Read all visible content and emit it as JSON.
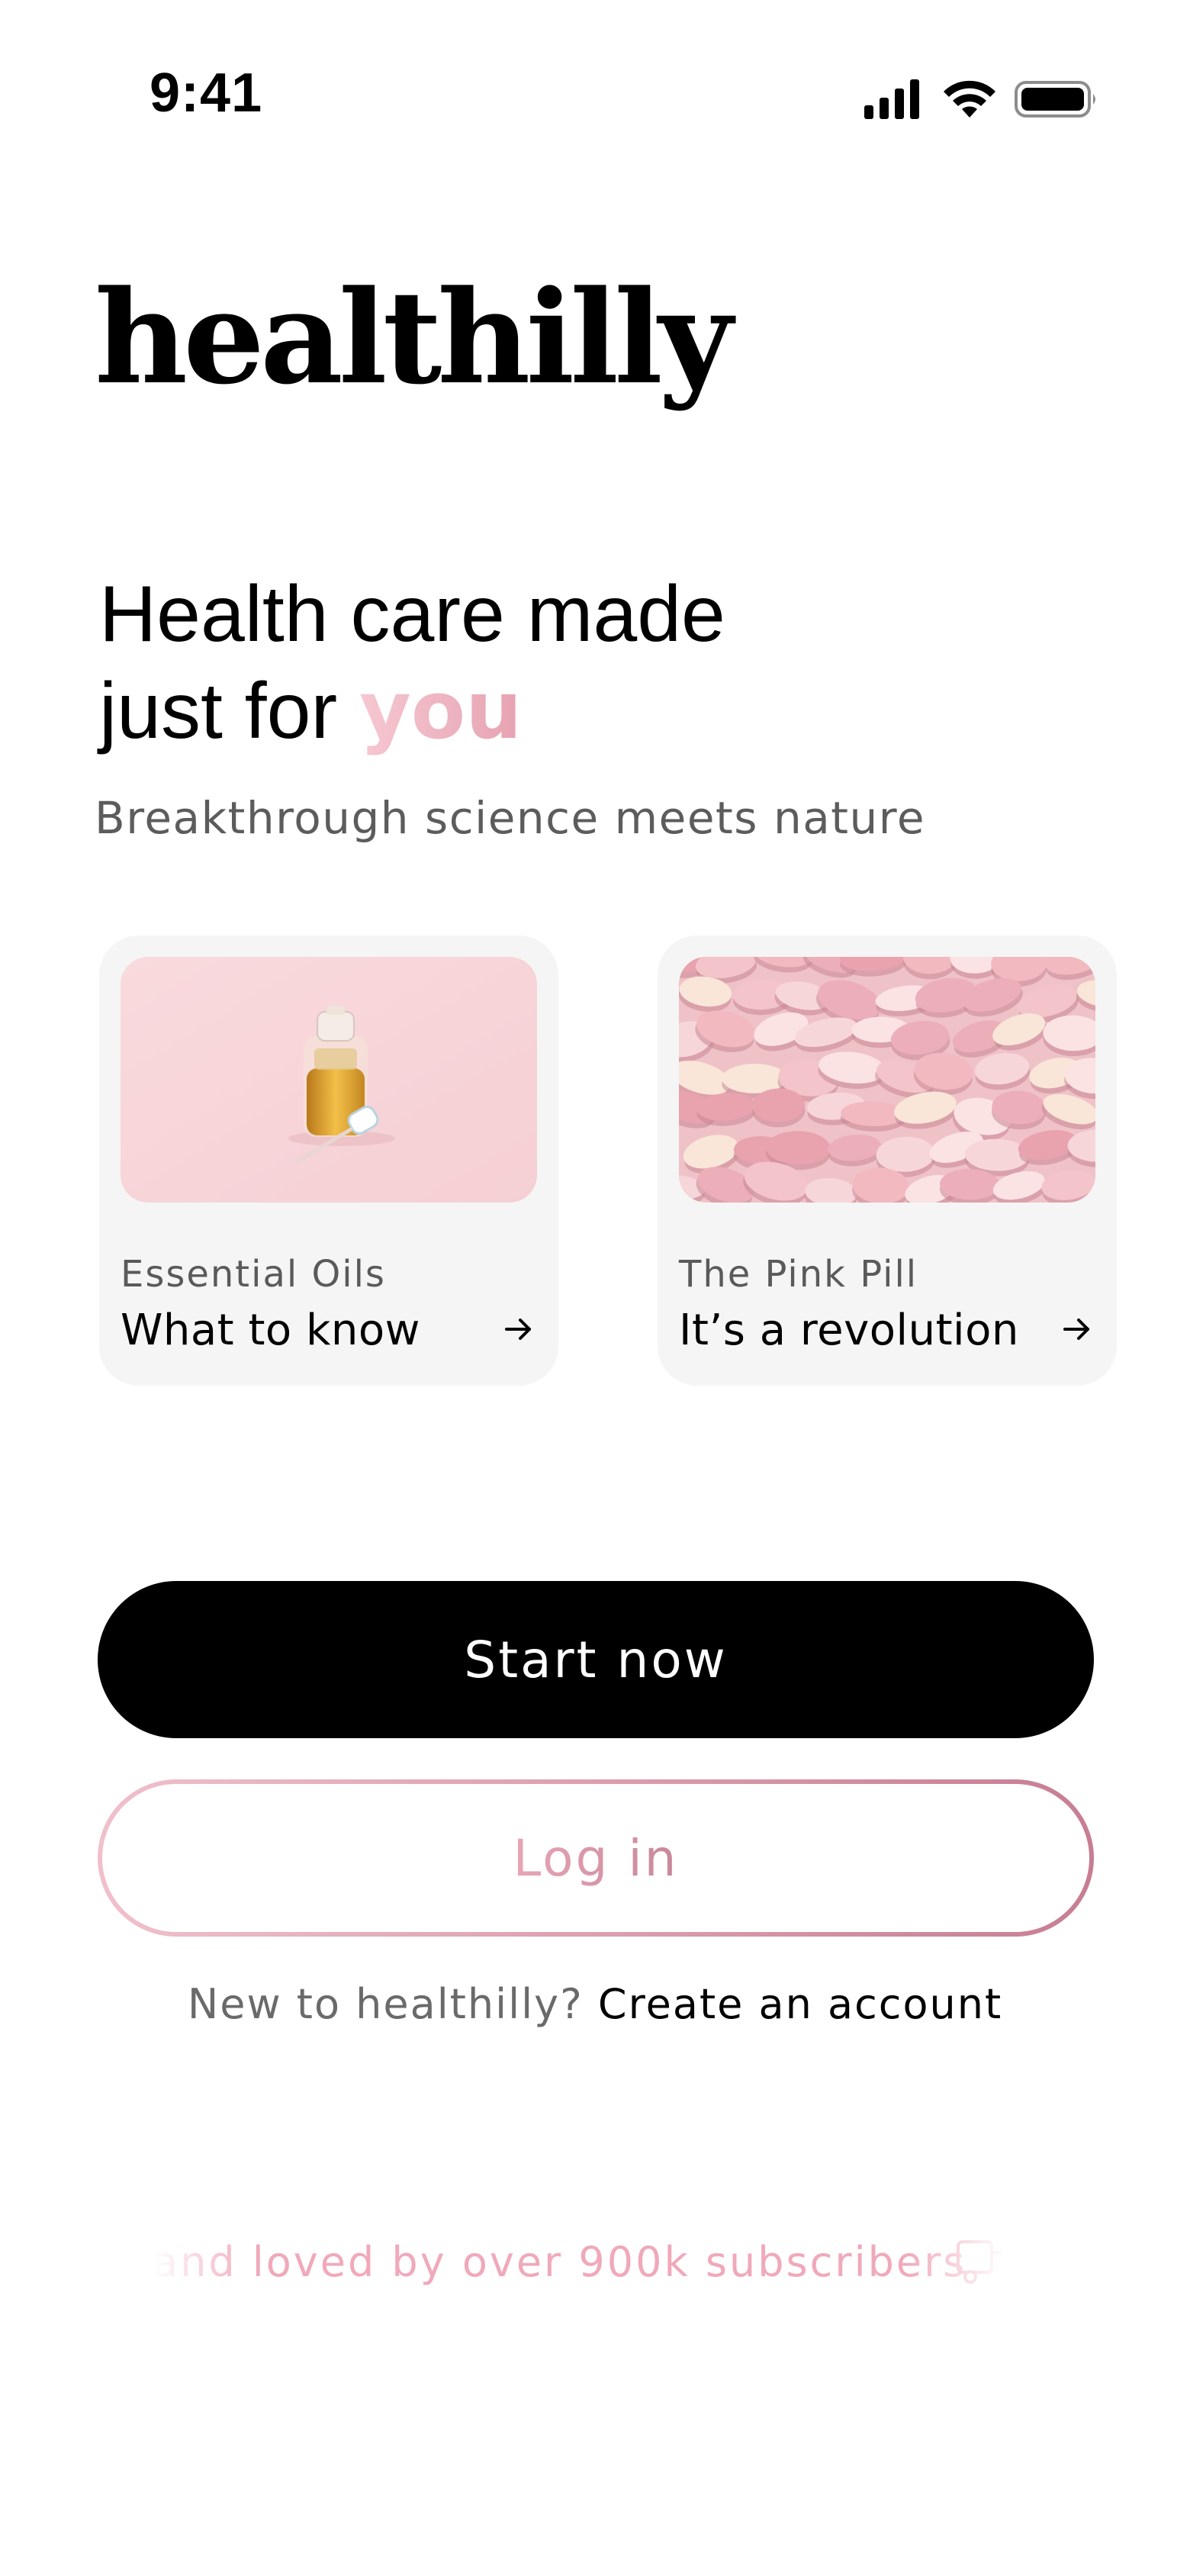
{
  "status_bar": {
    "time": "9:41",
    "icons": [
      "signal-icon",
      "wifi-icon",
      "battery-icon"
    ]
  },
  "brand": {
    "logo": "healthilly"
  },
  "hero": {
    "headline_line1": "Health care made",
    "headline_line2_prefix": "just for ",
    "headline_accent": "you",
    "subheadline": "Breakthrough science meets nature"
  },
  "cards": [
    {
      "eyebrow": "Essential Oils",
      "title": "What to know",
      "arrow_icon": "arrow-right-icon"
    },
    {
      "eyebrow": "The Pink Pill",
      "title": "It’s a revolution",
      "arrow_icon": "arrow-right-icon"
    }
  ],
  "actions": {
    "start_label": "Start now",
    "login_label": "Log in",
    "signup_prompt": "New to healthilly? ",
    "signup_link": "Create an account"
  },
  "social_proof": {
    "text": "and loved by over 900k subscribers",
    "icon": "delivery-truck-icon"
  },
  "colors": {
    "accent_pink": "#f1b8c4",
    "primary_button": "#000000",
    "card_background": "#f5f5f5"
  }
}
